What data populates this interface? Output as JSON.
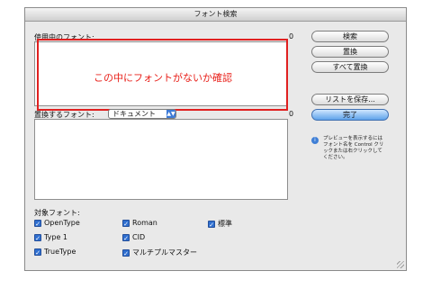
{
  "window": {
    "title": "フォント検索"
  },
  "fonts_in_use": {
    "label": "使用中のフォント:",
    "count": "0"
  },
  "annotation": {
    "text": "この中にフォントがないか確認",
    "color": "#e02020"
  },
  "replace": {
    "label": "置換するフォント:",
    "count": "0",
    "popup_value": "ドキュメント"
  },
  "buttons": {
    "find": "検索",
    "replace": "置換",
    "replace_all": "すべて置換",
    "save_list": "リストを保存...",
    "done": "完了"
  },
  "hint": {
    "text": "プレビューを表示するにはフォント名を Control クリックまたは右クリックしてください。"
  },
  "target": {
    "label": "対象フォント:",
    "checkboxes": [
      {
        "label": "OpenType",
        "checked": true
      },
      {
        "label": "Roman",
        "checked": true
      },
      {
        "label": "標準",
        "checked": true
      },
      {
        "label": "Type 1",
        "checked": true
      },
      {
        "label": "CID",
        "checked": true
      },
      {
        "label": "TrueType",
        "checked": true
      },
      {
        "label": "マルチプルマスター",
        "checked": true
      }
    ]
  },
  "icons": {
    "hint": "info-icon",
    "popup": "popup-arrows-icon",
    "check": "checkmark-icon",
    "resize": "resize-grip-icon"
  }
}
